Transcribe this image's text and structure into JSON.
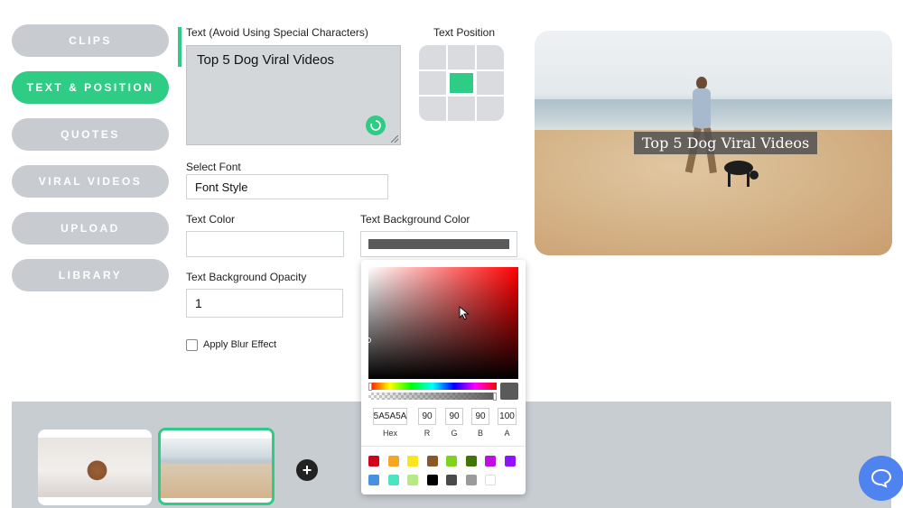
{
  "sidebar": {
    "items": [
      {
        "label": "CLIPS",
        "active": false
      },
      {
        "label": "TEXT & POSITION",
        "active": true
      },
      {
        "label": "QUOTES",
        "active": false
      },
      {
        "label": "VIRAL VIDEOS",
        "active": false
      },
      {
        "label": "UPLOAD",
        "active": false
      },
      {
        "label": "LIBRARY",
        "active": false
      }
    ]
  },
  "form": {
    "text_label": "Text (Avoid Using Special Characters)",
    "text_value": "Top 5 Dog Viral Videos",
    "position_label": "Text Position",
    "font_label": "Select Font",
    "font_value": "Font Style",
    "text_color_label": "Text Color",
    "text_color_value": "",
    "bg_color_label": "Text Background Color",
    "bg_color_value": "#5a5a5a",
    "opacity_label": "Text Background Opacity",
    "opacity_value": "1",
    "blur_label": "Apply Blur Effect",
    "blur_checked": false
  },
  "preview": {
    "overlay_text": "Top 5 Dog Viral Videos"
  },
  "color_picker": {
    "hex": "5A5A5A",
    "r": "90",
    "g": "90",
    "b": "90",
    "a": "100",
    "labels": {
      "hex": "Hex",
      "r": "R",
      "g": "G",
      "b": "B",
      "a": "A"
    },
    "presets": [
      "#d0021b",
      "#f5a623",
      "#f8e71c",
      "#8b572a",
      "#7ed321",
      "#417505",
      "#bd10e0",
      "#9013fe",
      "#4a90e2",
      "#50e3c2",
      "#b8e986",
      "#000000",
      "#4a4a4a",
      "#9b9b9b",
      "#ffffff"
    ]
  },
  "colors": {
    "accent": "#2fcc86",
    "sidebar_inactive": "#c8ccd1",
    "chat": "#4f83f0"
  },
  "timeline": {
    "clips": [
      {
        "name": "dachshund-clip",
        "selected": false
      },
      {
        "name": "beach-dog-walk-clip",
        "selected": true
      }
    ]
  }
}
